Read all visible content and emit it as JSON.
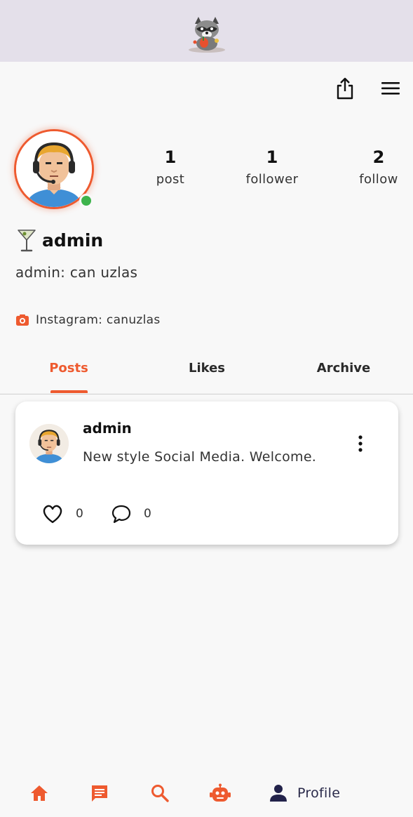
{
  "header": {
    "logo_icon": "raccoon-mascot-logo"
  },
  "toolbar": {
    "share_icon": "share-icon",
    "menu_icon": "hamburger-menu-icon"
  },
  "profile": {
    "avatar_icon": "headset-avatar",
    "online_color": "#3db34c",
    "stats": [
      {
        "value": "1",
        "label": "post"
      },
      {
        "value": "1",
        "label": "follower"
      },
      {
        "value": "2",
        "label": "follow"
      }
    ],
    "badge_icon": "cocktail-icon",
    "username": "admin",
    "bio": "admin: can uzlas",
    "instagram": "Instagram: canuzlas"
  },
  "tabs": [
    {
      "label": "Posts",
      "active": true
    },
    {
      "label": "Likes",
      "active": false
    },
    {
      "label": "Archive",
      "active": false
    }
  ],
  "posts": [
    {
      "author": "admin",
      "text": "New style Social Media. Welcome.",
      "likes": "0",
      "comments": "0"
    }
  ],
  "bottom_nav": {
    "items": [
      "home-icon",
      "messages-icon",
      "search-icon",
      "bot-icon",
      "person-icon"
    ],
    "active_label": "Profile"
  },
  "colors": {
    "accent": "#ee5a2f",
    "header_bg": "#e4e0ea",
    "background": "#f8f8f8"
  }
}
